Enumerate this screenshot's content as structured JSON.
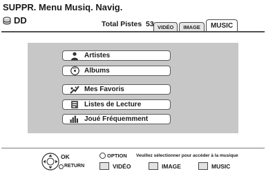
{
  "header": {
    "title": "SUPPR. Menu Musiq. Navig.",
    "disc_label": "DD",
    "disc_icon": "hdd-icon",
    "total_tracks_label": "Total Pistes",
    "total_tracks_value": "53"
  },
  "tabs": [
    {
      "label": "VIDÉO",
      "active": false
    },
    {
      "label": "IMAGE",
      "active": false
    },
    {
      "label": "MUSIC",
      "active": true
    }
  ],
  "menu": {
    "items": [
      {
        "label": "Artistes",
        "icon": "person-icon",
        "selected": true
      },
      {
        "label": "Albums",
        "icon": "disc-icon",
        "selected": false
      },
      {
        "label": "Mes Favoris",
        "icon": "favorite-music-icon",
        "selected": false
      },
      {
        "label": "Listes de Lecture",
        "icon": "playlist-icon",
        "selected": false
      },
      {
        "label": "Joué Fréquemment",
        "icon": "frequently-played-icon",
        "selected": false
      }
    ]
  },
  "footer": {
    "ok_label": "OK",
    "return_label": "RETURN",
    "option_label": "OPTION",
    "hint": "Veuillez sélectionner pour accéder à la musique",
    "color_buttons": [
      {
        "label": "VIDÉO"
      },
      {
        "label": "IMAGE"
      },
      {
        "label": "MUSIC"
      }
    ]
  },
  "colors": {
    "panel": "#c7c7c7",
    "border": "#505050",
    "background": "#ffffff"
  }
}
